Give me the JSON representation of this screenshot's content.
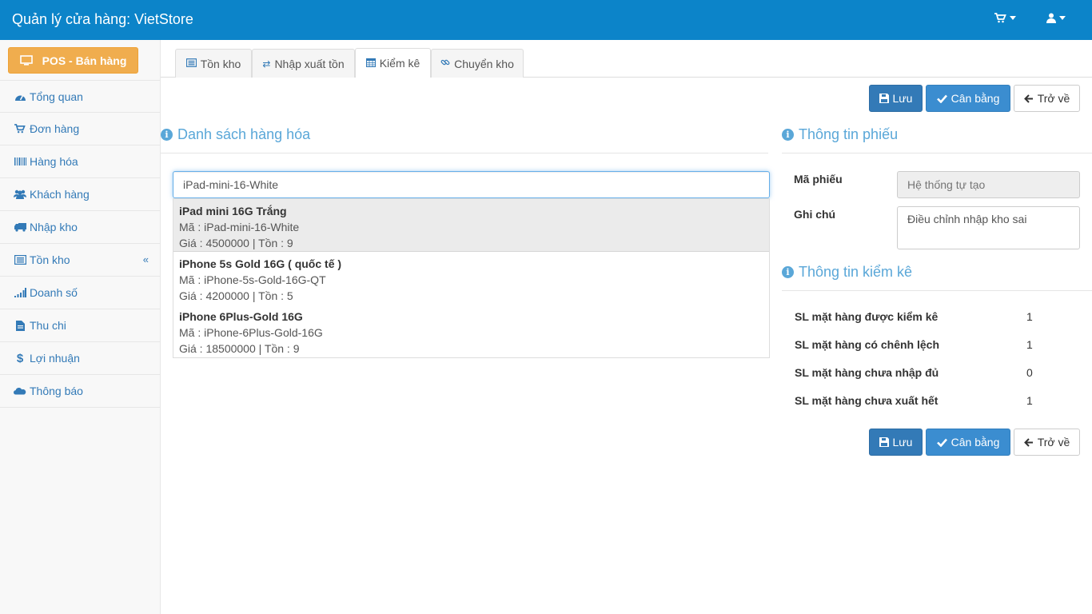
{
  "header": {
    "brand": "Quản lý cửa hàng: VietStore",
    "cart_icon": "shopping-cart-icon",
    "user_icon": "user-icon"
  },
  "sidebar": {
    "pos_button": "POS - Bán hàng",
    "items": [
      {
        "label": "Tổng quan",
        "icon": "dashboard-icon"
      },
      {
        "label": "Đơn hàng",
        "icon": "shopping-cart-icon"
      },
      {
        "label": "Hàng hóa",
        "icon": "barcode-icon"
      },
      {
        "label": "Khách hàng",
        "icon": "users-icon"
      },
      {
        "label": "Nhập kho",
        "icon": "truck-icon"
      },
      {
        "label": "Tồn kho",
        "icon": "list-alt-icon"
      },
      {
        "label": "Doanh số",
        "icon": "signal-icon"
      },
      {
        "label": "Thu chi",
        "icon": "file-icon"
      },
      {
        "label": "Lợi nhuận",
        "icon": "dollar-icon"
      },
      {
        "label": "Thông báo",
        "icon": "cloud-icon"
      }
    ],
    "collapse_glyph": "«"
  },
  "tabs": [
    {
      "label": "Tồn kho",
      "icon": "list-alt-icon"
    },
    {
      "label": "Nhập xuất tồn",
      "icon": "exchange-icon"
    },
    {
      "label": "Kiểm kê",
      "icon": "calendar-icon",
      "active": true
    },
    {
      "label": "Chuyển kho",
      "icon": "link-icon"
    }
  ],
  "actions": {
    "save": "Lưu",
    "balance": "Cân bằng",
    "back": "Trở về"
  },
  "products": {
    "title": "Danh sách hàng hóa",
    "search_value": "iPad-mini-16-White",
    "suggestions": [
      {
        "name": "iPad mini 16G Trắng",
        "code": "Mã : iPad-mini-16-White",
        "price": "Giá : 4500000 | Tồn : 9"
      },
      {
        "name": "iPhone 5s Gold 16G ( quốc tế )",
        "code": "Mã : iPhone-5s-Gold-16G-QT",
        "price": "Giá : 4200000 | Tồn : 5"
      },
      {
        "name": "iPhone 6Plus-Gold 16G",
        "code": "Mã : iPhone-6Plus-Gold-16G",
        "price": "Giá : 18500000 | Tồn : 9"
      }
    ]
  },
  "voucher": {
    "title": "Thông tin phiếu",
    "code_label": "Mã phiếu",
    "code_placeholder": "Hệ thống tự tạo",
    "note_label": "Ghi chú",
    "note_value": "Điều chỉnh nhập kho sai"
  },
  "stocktake": {
    "title": "Thông tin kiểm kê",
    "rows": [
      {
        "label": "SL mặt hàng được kiểm kê",
        "value": "1"
      },
      {
        "label": "SL mặt hàng có chênh lệch",
        "value": "1"
      },
      {
        "label": "SL mặt hàng chưa nhập đủ",
        "value": "0"
      },
      {
        "label": "SL mặt hàng chưa xuất hết",
        "value": "1"
      }
    ]
  },
  "colors": {
    "topbar": "#0c84c9",
    "accent": "#337ab7",
    "warning": "#f0ad4e",
    "section_title": "#5aa7d8"
  }
}
